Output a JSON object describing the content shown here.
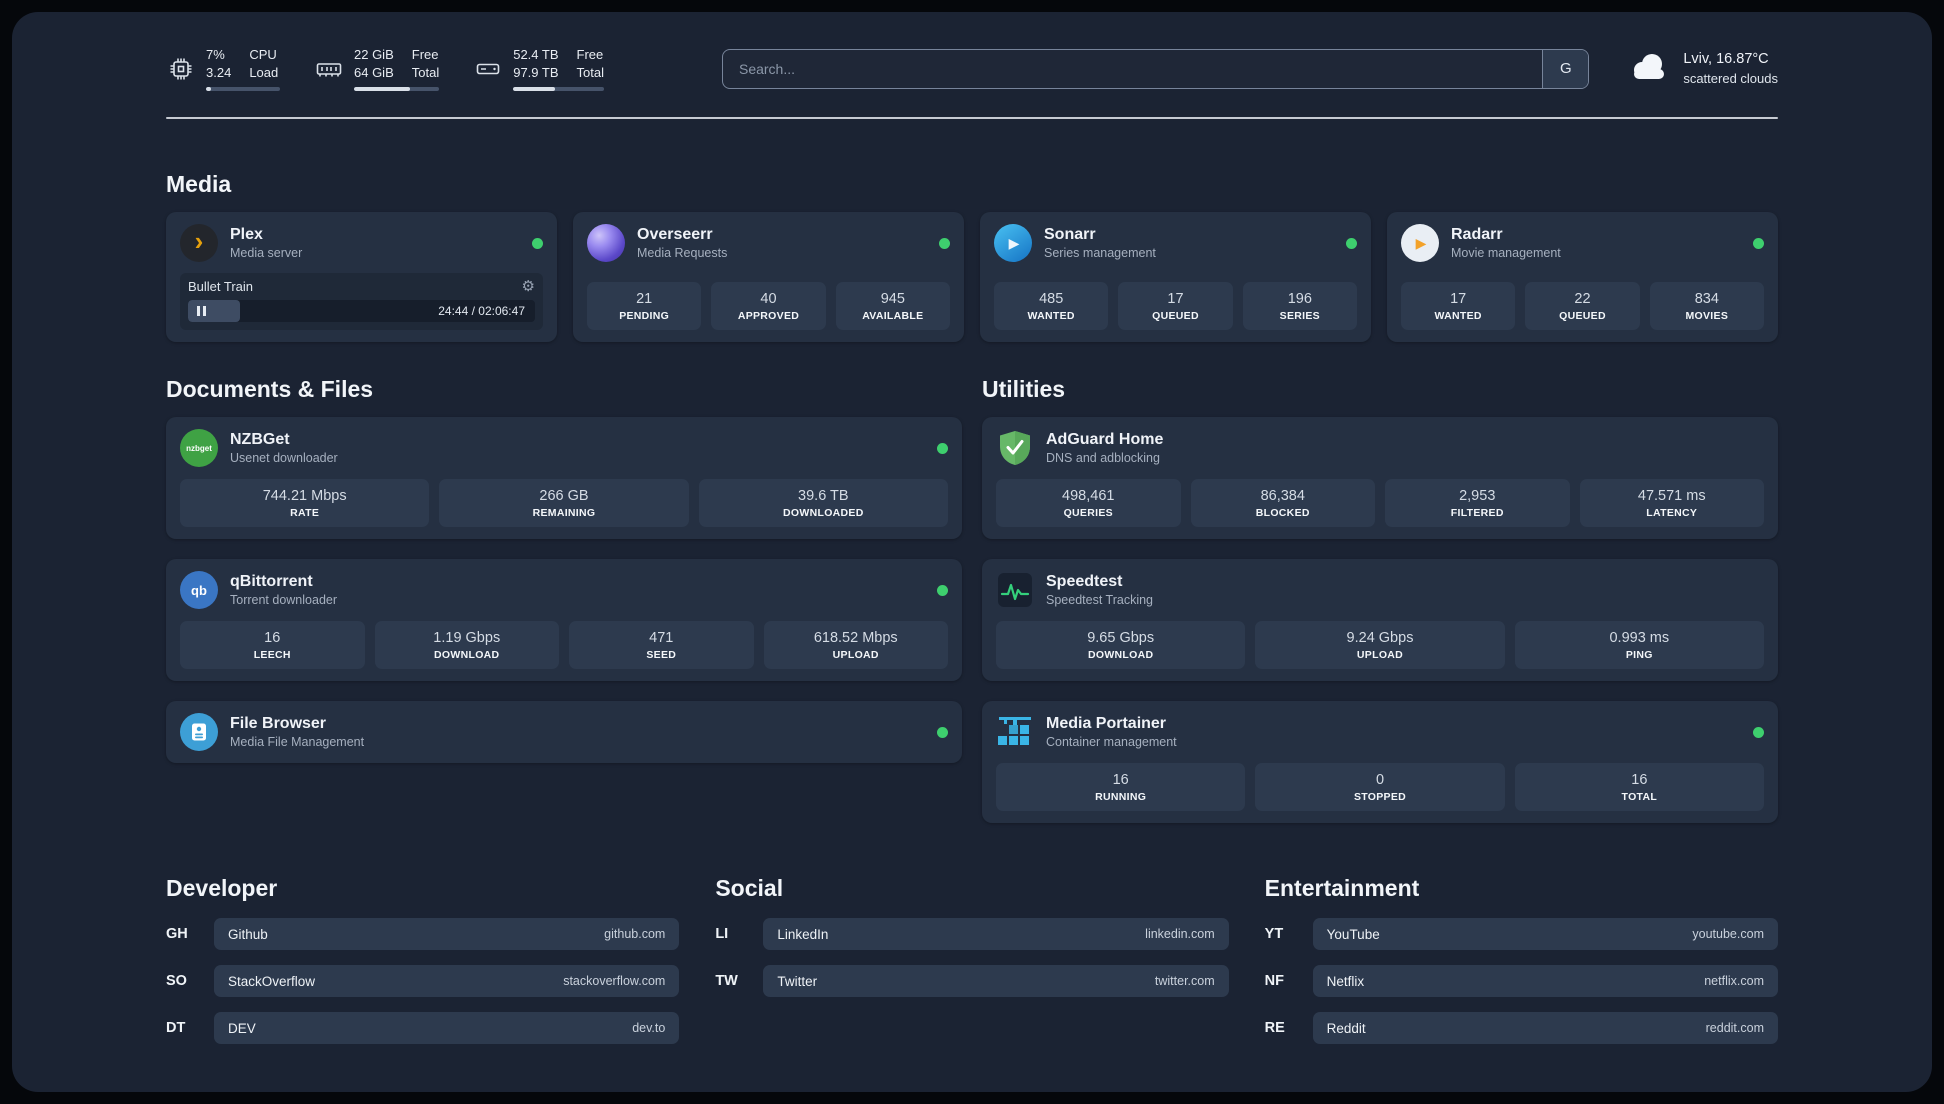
{
  "topbar": {
    "metrics": [
      {
        "icon": "cpu",
        "line1": "7%",
        "line2": "3.24",
        "label1": "CPU",
        "label2": "Load",
        "bar_pct": 7
      },
      {
        "icon": "ram",
        "line1": "22 GiB",
        "line2": "64 GiB",
        "label1": "Free",
        "label2": "Total",
        "bar_pct": 66
      },
      {
        "icon": "disk",
        "line1": "52.4 TB",
        "line2": "97.9 TB",
        "label1": "Free",
        "label2": "Total",
        "bar_pct": 46
      }
    ],
    "search": {
      "placeholder": "Search...",
      "engine_label": "G"
    },
    "weather": {
      "location": "Lviv, 16.87°C",
      "condition": "scattered clouds",
      "icon": "cloud"
    }
  },
  "sections": {
    "media": "Media",
    "documents": "Documents & Files",
    "utilities": "Utilities",
    "developer": "Developer",
    "social": "Social",
    "entertainment": "Entertainment"
  },
  "colors": {
    "status_online": "#3ecf6e",
    "plex_accent": "#e5a00d"
  },
  "apps": {
    "plex": {
      "name": "Plex",
      "desc": "Media server",
      "status": "online",
      "now_playing": "Bullet Train",
      "time": "24:44 / 02:06:47",
      "progress_pct": 15
    },
    "overseerr": {
      "name": "Overseerr",
      "desc": "Media Requests",
      "status": "online",
      "stats": [
        {
          "value": "21",
          "label": "PENDING"
        },
        {
          "value": "40",
          "label": "APPROVED"
        },
        {
          "value": "945",
          "label": "AVAILABLE"
        }
      ]
    },
    "sonarr": {
      "name": "Sonarr",
      "desc": "Series management",
      "status": "online",
      "stats": [
        {
          "value": "485",
          "label": "WANTED"
        },
        {
          "value": "17",
          "label": "QUEUED"
        },
        {
          "value": "196",
          "label": "SERIES"
        }
      ]
    },
    "radarr": {
      "name": "Radarr",
      "desc": "Movie management",
      "status": "online",
      "stats": [
        {
          "value": "17",
          "label": "WANTED"
        },
        {
          "value": "22",
          "label": "QUEUED"
        },
        {
          "value": "834",
          "label": "MOVIES"
        }
      ]
    },
    "nzbget": {
      "name": "NZBGet",
      "desc": "Usenet downloader",
      "status": "online",
      "stats": [
        {
          "value": "744.21 Mbps",
          "label": "RATE"
        },
        {
          "value": "266 GB",
          "label": "REMAINING"
        },
        {
          "value": "39.6 TB",
          "label": "DOWNLOADED"
        }
      ]
    },
    "qbittorrent": {
      "name": "qBittorrent",
      "desc": "Torrent downloader",
      "status": "online",
      "stats": [
        {
          "value": "16",
          "label": "LEECH"
        },
        {
          "value": "1.19 Gbps",
          "label": "DOWNLOAD"
        },
        {
          "value": "471",
          "label": "SEED"
        },
        {
          "value": "618.52 Mbps",
          "label": "UPLOAD"
        }
      ]
    },
    "filebrowser": {
      "name": "File Browser",
      "desc": "Media File Management",
      "status": "online"
    },
    "adguard": {
      "name": "AdGuard Home",
      "desc": "DNS and adblocking",
      "stats": [
        {
          "value": "498,461",
          "label": "QUERIES"
        },
        {
          "value": "86,384",
          "label": "BLOCKED"
        },
        {
          "value": "2,953",
          "label": "FILTERED"
        },
        {
          "value": "47.571 ms",
          "label": "LATENCY"
        }
      ]
    },
    "speedtest": {
      "name": "Speedtest",
      "desc": "Speedtest Tracking",
      "stats": [
        {
          "value": "9.65 Gbps",
          "label": "DOWNLOAD"
        },
        {
          "value": "9.24 Gbps",
          "label": "UPLOAD"
        },
        {
          "value": "0.993 ms",
          "label": "PING"
        }
      ]
    },
    "portainer": {
      "name": "Media Portainer",
      "desc": "Container management",
      "status": "online",
      "stats": [
        {
          "value": "16",
          "label": "RUNNING"
        },
        {
          "value": "0",
          "label": "STOPPED"
        },
        {
          "value": "16",
          "label": "TOTAL"
        }
      ]
    }
  },
  "links": {
    "developer": [
      {
        "abbr": "GH",
        "name": "Github",
        "url": "github.com"
      },
      {
        "abbr": "SO",
        "name": "StackOverflow",
        "url": "stackoverflow.com"
      },
      {
        "abbr": "DT",
        "name": "DEV",
        "url": "dev.to"
      }
    ],
    "social": [
      {
        "abbr": "LI",
        "name": "LinkedIn",
        "url": "linkedin.com"
      },
      {
        "abbr": "TW",
        "name": "Twitter",
        "url": "twitter.com"
      }
    ],
    "entertainment": [
      {
        "abbr": "YT",
        "name": "YouTube",
        "url": "youtube.com"
      },
      {
        "abbr": "NF",
        "name": "Netflix",
        "url": "netflix.com"
      },
      {
        "abbr": "RE",
        "name": "Reddit",
        "url": "reddit.com"
      }
    ]
  }
}
